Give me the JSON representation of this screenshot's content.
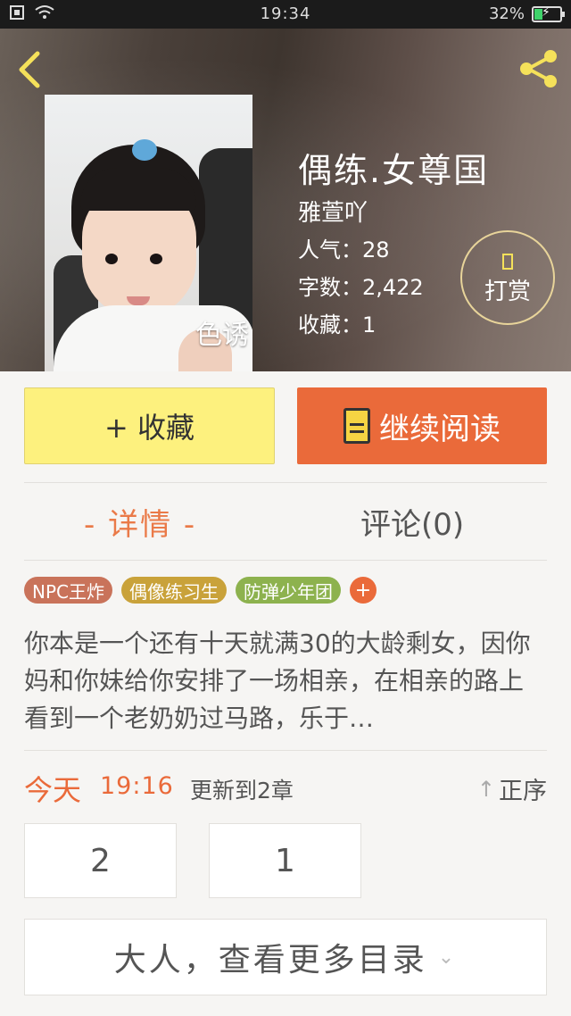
{
  "status_bar": {
    "time": "19:34",
    "battery": "32%",
    "battery_level": 0.32
  },
  "book": {
    "title": "偶练.女尊国",
    "author": "雅萱吖",
    "popularity": "人气：28",
    "word_count": "字数：2,422",
    "favorites": "收藏：1",
    "cover_caption": "色诱",
    "tip_label": "打赏"
  },
  "actions": {
    "collect": "+ 收藏",
    "continue_reading": "继续阅读"
  },
  "tabs": {
    "detail": "- 详情 -",
    "comments": "评论(0)"
  },
  "tags": [
    {
      "label": "NPC王炸",
      "color": "#c9735a"
    },
    {
      "label": "偶像练习生",
      "color": "#c9a23a"
    },
    {
      "label": "防弹少年团",
      "color": "#8db24e"
    }
  ],
  "tag_add": "+",
  "synopsis": "你本是一个还有十天就满30的大龄剩女，因你妈和你妹给你安排了一场相亲，在相亲的路上看到一个老奶奶过马路，乐于…",
  "update": {
    "day": "今天",
    "time": "19:16",
    "text": "更新到2章",
    "sort": "正序"
  },
  "chapters": [
    "2",
    "1"
  ],
  "more_catalog": "大人，查看更多目录",
  "colors": {
    "accent": "#ea6a3a",
    "collect_bg": "#fdf17e"
  }
}
